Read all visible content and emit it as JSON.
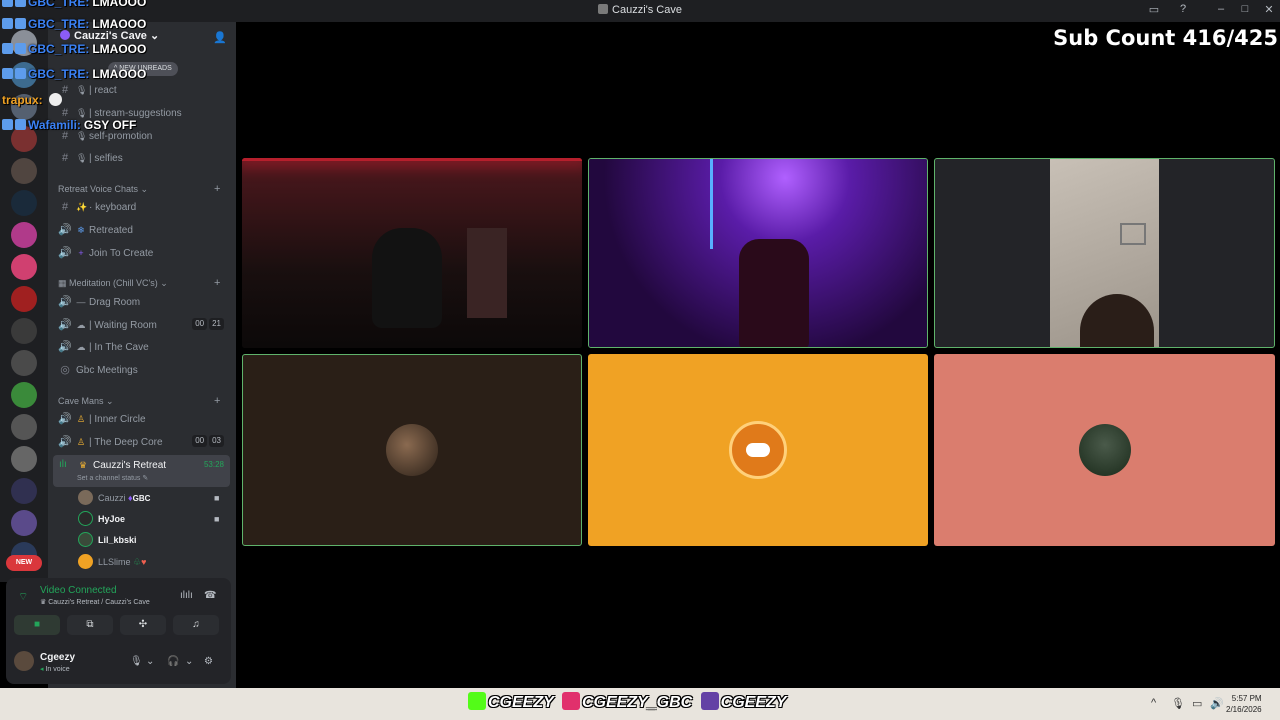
{
  "window": {
    "title": "Cauzzi's Cave"
  },
  "sidebar": {
    "server_name": "Cauzzi's Cave",
    "new_unreads": "NEW UNREADS",
    "channels_top": [
      {
        "label": "| react"
      },
      {
        "label": "| stream-suggestions"
      },
      {
        "label": "self-promotion"
      },
      {
        "label": "| selfies"
      }
    ],
    "cat_retreat": "Retreat Voice Chats",
    "retreat_channels": [
      {
        "label": "keyboard"
      },
      {
        "label": "Retreated"
      },
      {
        "label": "Join To Create"
      }
    ],
    "cat_meditation": "Meditation (Chill VC's)",
    "meditation_channels": [
      {
        "label": "Drag Room"
      },
      {
        "label": "| Waiting Room",
        "pill_a": "00",
        "pill_b": "21"
      },
      {
        "label": "| In The Cave"
      },
      {
        "label": "Gbc Meetings"
      }
    ],
    "cat_cave": "Cave Mans",
    "cave_channels": [
      {
        "label": "| Inner Circle"
      },
      {
        "label": "| The Deep Core",
        "pill_a": "00",
        "pill_b": "03"
      }
    ],
    "active_channel": {
      "label": "Cauzzi's Retreat",
      "timer": "53:28",
      "status": "Set a channel status"
    },
    "voice_users": [
      {
        "name": "Cauzzi",
        "tag": "GBC",
        "color": "#949ba4"
      },
      {
        "name": "HyJoe",
        "color": "#f2f3f5"
      },
      {
        "name": "Lil_kbski",
        "color": "#f2f3f5"
      },
      {
        "name": "LLSlime",
        "color": "#949ba4"
      }
    ],
    "new_badge": "NEW"
  },
  "voice_panel": {
    "status": "Video Connected",
    "location": "Cauzzi's Retreat / Cauzzi's Cave",
    "username": "Cgeezy",
    "user_status": "In voice"
  },
  "overlay": {
    "chat": [
      {
        "name": "GBC_TRE:",
        "msg": "LMAOOO"
      },
      {
        "name": "GBC_TRE:",
        "msg": "LMAOOO"
      },
      {
        "name": "GBC_TRE:",
        "msg": "LMAOOO"
      },
      {
        "name": "GBC_TRE:",
        "msg": "LMAOOO"
      },
      {
        "name": "trapux:",
        "msg": ""
      },
      {
        "name": "Wafamili:",
        "msg": "GSY OFF"
      }
    ],
    "sub_count": "Sub Count 416/425"
  },
  "socials": {
    "kick": "CGEEZY",
    "instagram": "CGEEZY_GBC",
    "twitch": "CGEEZY"
  },
  "taskbar": {
    "time": "5:57 PM",
    "date": "2/16/2026"
  },
  "colors": {
    "accent_green": "#23a55a",
    "tile_orange": "#f0a224",
    "tile_pink": "#da7d6e",
    "tile_brown": "#2a1f17"
  }
}
